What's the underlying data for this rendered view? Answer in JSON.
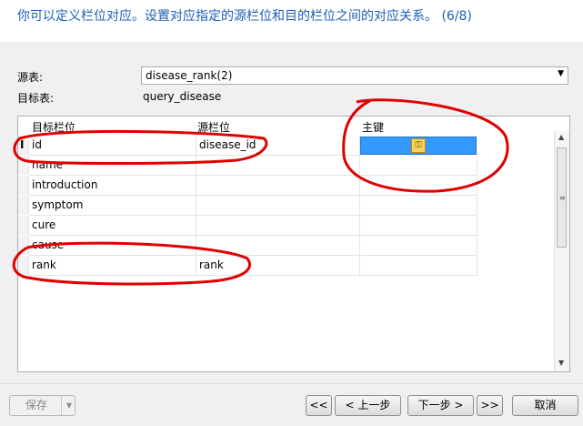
{
  "header": {
    "title": "你可以定义栏位对应。设置对应指定的源栏位和目的栏位之间的对应关系。 (6/8)"
  },
  "form": {
    "source_label": "源表:",
    "source_value": "disease_rank(2)",
    "target_label": "目标表:",
    "target_value": "query_disease"
  },
  "grid": {
    "columns": [
      "目标栏位",
      "源栏位",
      "主键"
    ],
    "rows": [
      {
        "target": "id",
        "source": "disease_id",
        "primary_key": true
      },
      {
        "target": "name",
        "source": ""
      },
      {
        "target": "introduction",
        "source": ""
      },
      {
        "target": "symptom",
        "source": ""
      },
      {
        "target": "cure",
        "source": ""
      },
      {
        "target": "cause",
        "source": ""
      },
      {
        "target": "rank",
        "source": "rank"
      }
    ],
    "cursor_glyph": "I"
  },
  "footer": {
    "save_label": "保存",
    "first_label": "<<",
    "prev_label": "< 上一步",
    "next_label": "下一步 >",
    "last_label": ">>",
    "cancel_label": "取消"
  },
  "icons": {
    "combo_arrow": "▼",
    "scroll_up": "▲",
    "scroll_down": "▼",
    "grip": "≡",
    "key": "⚿",
    "dropdown": "▾"
  },
  "colors": {
    "header_text": "#1c5fb8",
    "selection": "#3399ff",
    "annotation": "#e00000"
  }
}
